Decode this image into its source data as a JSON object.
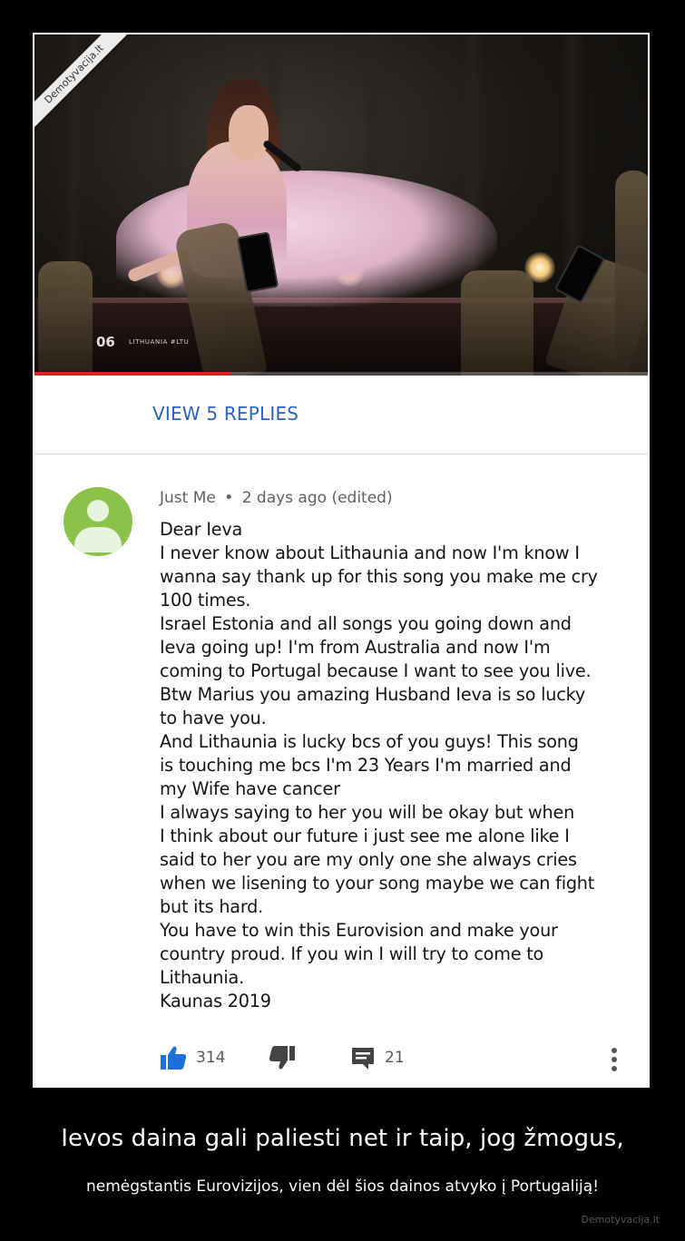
{
  "watermark": "Demotyvacija.lt",
  "video": {
    "counter": "06",
    "country": "LITHUANIA #LTU",
    "progress_fraction": 0.32
  },
  "replies": {
    "link_label": "VIEW 5 REPLIES"
  },
  "comment": {
    "author": "Just Me",
    "separator": "•",
    "time": "2 days ago (edited)",
    "lines": [
      "Dear Ieva",
      "I never know about Lithaunia and now I'm know I",
      "wanna say thank up for this song you make me cry",
      "100 times.",
      "Israel Estonia and all songs you going down and",
      "Ieva going up! I'm from Australia and now I'm",
      "coming to Portugal because I want to see you live.",
      "Btw Marius you amazing Husband Ieva is so lucky",
      "to have you.",
      "And Lithaunia is lucky bcs of you guys! This song",
      "is touching me bcs I'm 23 Years I'm married and",
      "my Wife have cancer",
      "I always saying to her you will be okay but when",
      "I think about our future i just see me alone like I",
      "said to her you are my only one she always cries",
      "when we lisening to your song maybe we can fight",
      "but its hard.",
      "You have to win this Eurovision and make your",
      "country proud. If you win I will try to come to",
      "Lithaunia.",
      "Kaunas 2019"
    ],
    "likes": "314",
    "replies_count": "21",
    "avatar_color": "#8bc34a"
  },
  "caption": {
    "title": "Ievos daina gali paliesti net ir taip, jog žmogus,",
    "subtitle": "nemėgstantis Eurovizijos, vien dėl šios dainos atvyko į Portugaliją!"
  },
  "site_mark": "Demotyvacija.lt",
  "colors": {
    "link_blue": "#2a63c4",
    "like_blue": "#1a6fd8",
    "progress_red": "#e02020"
  }
}
